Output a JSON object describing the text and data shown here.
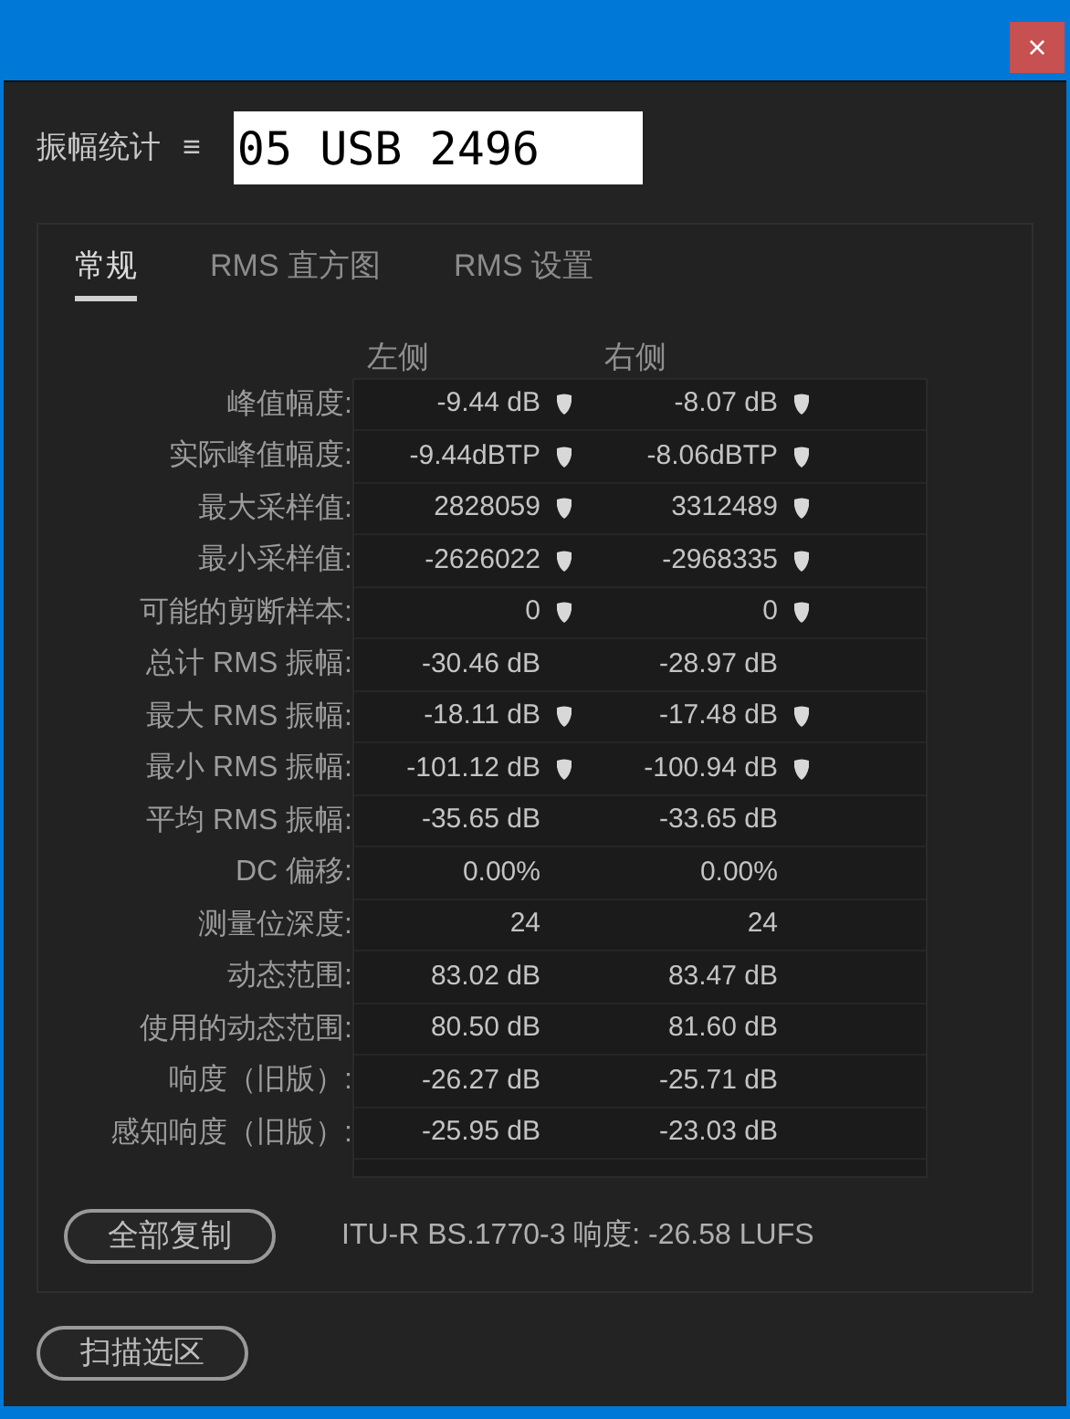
{
  "window": {
    "close": "×"
  },
  "header": {
    "title": "振幅统计",
    "menu": "≡",
    "field_value": "05 USB 2496"
  },
  "tabs": [
    {
      "label": "常规",
      "selected": true
    },
    {
      "label": "RMS 直方图",
      "selected": false
    },
    {
      "label": "RMS 设置",
      "selected": false
    }
  ],
  "columns": [
    "左侧",
    "右侧"
  ],
  "rows": [
    {
      "label": "峰值幅度:",
      "left": {
        "text": "-9.44 dB",
        "marker": true
      },
      "right": {
        "text": "-8.07 dB",
        "marker": true
      }
    },
    {
      "label": "实际峰值幅度:",
      "left": {
        "text": "-9.44dBTP",
        "marker": true
      },
      "right": {
        "text": "-8.06dBTP",
        "marker": true
      }
    },
    {
      "label": "最大采样值:",
      "left": {
        "text": "2828059",
        "marker": true
      },
      "right": {
        "text": "3312489",
        "marker": true
      }
    },
    {
      "label": "最小采样值:",
      "left": {
        "text": "-2626022",
        "marker": true
      },
      "right": {
        "text": "-2968335",
        "marker": true
      }
    },
    {
      "label": "可能的剪断样本:",
      "left": {
        "text": "0",
        "marker": true
      },
      "right": {
        "text": "0",
        "marker": true
      }
    },
    {
      "label": "总计 RMS 振幅:",
      "left": {
        "text": "-30.46 dB",
        "marker": false
      },
      "right": {
        "text": "-28.97 dB",
        "marker": false
      }
    },
    {
      "label": "最大 RMS 振幅:",
      "left": {
        "text": "-18.11 dB",
        "marker": true
      },
      "right": {
        "text": "-17.48 dB",
        "marker": true
      }
    },
    {
      "label": "最小 RMS 振幅:",
      "left": {
        "text": "-101.12 dB",
        "marker": true
      },
      "right": {
        "text": "-100.94 dB",
        "marker": true
      }
    },
    {
      "label": "平均 RMS 振幅:",
      "left": {
        "text": "-35.65 dB",
        "marker": false
      },
      "right": {
        "text": "-33.65 dB",
        "marker": false
      }
    },
    {
      "label": "DC 偏移:",
      "left": {
        "text": "0.00%",
        "marker": false
      },
      "right": {
        "text": "0.00%",
        "marker": false
      }
    },
    {
      "label": "测量位深度:",
      "left": {
        "text": "24",
        "marker": false
      },
      "right": {
        "text": "24",
        "marker": false
      }
    },
    {
      "label": "动态范围:",
      "left": {
        "text": "83.02 dB",
        "marker": false
      },
      "right": {
        "text": "83.47 dB",
        "marker": false
      }
    },
    {
      "label": "使用的动态范围:",
      "left": {
        "text": "80.50 dB",
        "marker": false
      },
      "right": {
        "text": "81.60 dB",
        "marker": false
      }
    },
    {
      "label": "响度（旧版）:",
      "left": {
        "text": "-26.27 dB",
        "marker": false
      },
      "right": {
        "text": "-25.71 dB",
        "marker": false
      }
    },
    {
      "label": "感知响度（旧版）:",
      "left": {
        "text": "-25.95 dB",
        "marker": false
      },
      "right": {
        "text": "-23.03 dB",
        "marker": false
      }
    }
  ],
  "copy_button": "全部复制",
  "loudness": "ITU-R BS.1770-3 响度: -26.58 LUFS",
  "scan_button": "扫描选区"
}
